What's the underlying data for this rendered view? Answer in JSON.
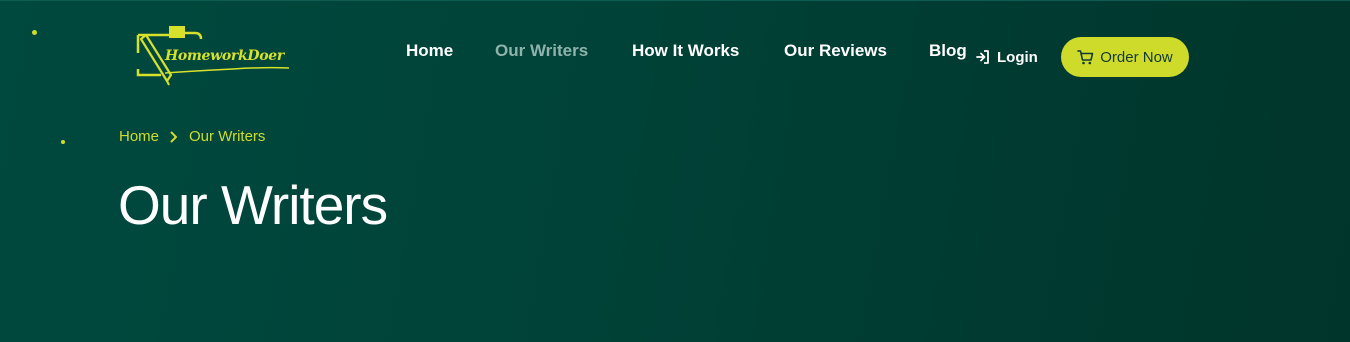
{
  "brand": {
    "name": "HomeworkDoer",
    "accent_color": "#cfdb2b",
    "background_color": "#004a3f"
  },
  "nav": {
    "items": [
      {
        "label": "Home",
        "active": false
      },
      {
        "label": "Our Writers",
        "active": true
      },
      {
        "label": "How It Works",
        "active": false
      },
      {
        "label": "Our Reviews",
        "active": false
      },
      {
        "label": "Blog",
        "active": false
      }
    ]
  },
  "header": {
    "login_label": "Login",
    "login_icon": "login-arrow-icon",
    "order_label": "Order Now",
    "order_icon": "cart-icon"
  },
  "breadcrumb": {
    "items": [
      "Home",
      "Our Writers"
    ],
    "separator_icon": "chevron-right-icon"
  },
  "hero": {
    "title": "Our Writers"
  }
}
